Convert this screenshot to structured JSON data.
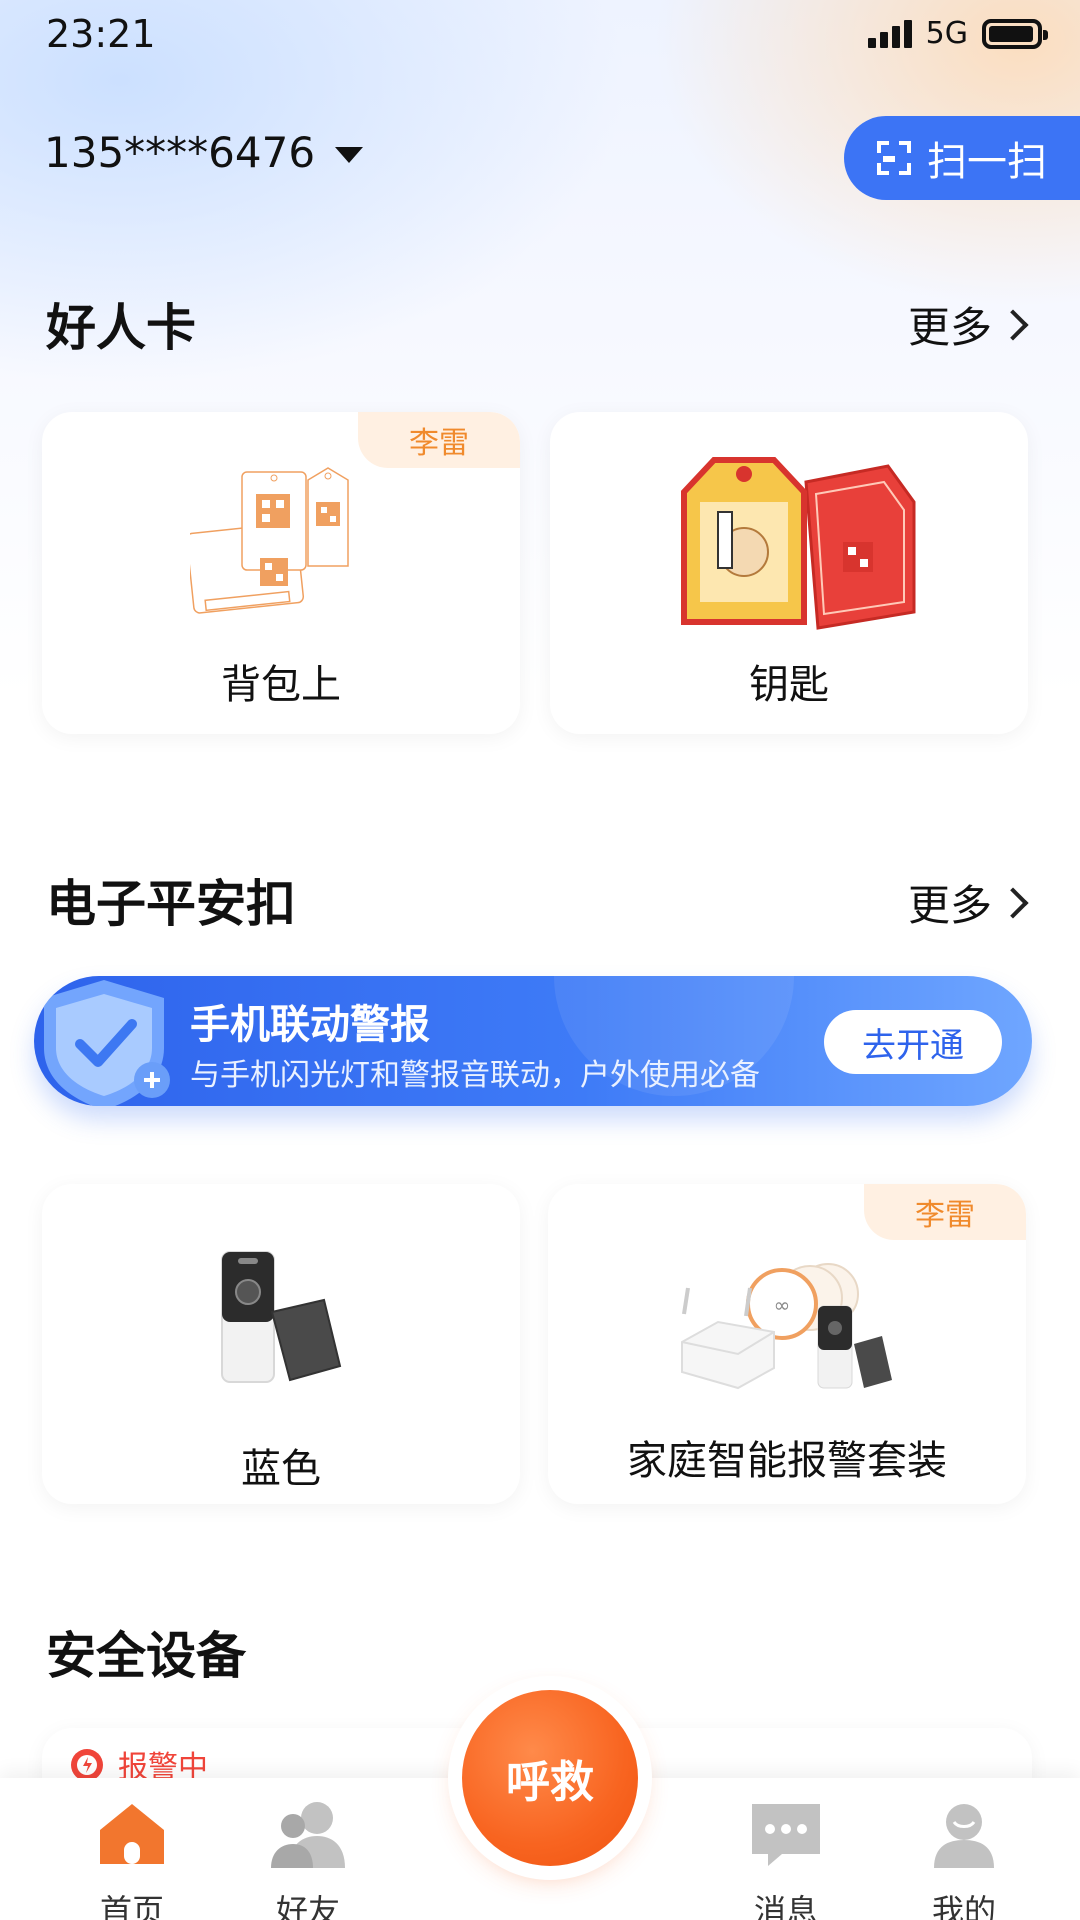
{
  "status_bar": {
    "time": "23:21",
    "network": "5G"
  },
  "header": {
    "account": "135****6476",
    "scan_label": "扫一扫"
  },
  "good_person_card": {
    "title": "好人卡",
    "more_label": "更多",
    "cards": [
      {
        "label": "背包上",
        "owner": "李雷"
      },
      {
        "label": "钥匙"
      }
    ]
  },
  "safety_button": {
    "title": "电子平安扣",
    "more_label": "更多",
    "banner": {
      "title": "手机联动警报",
      "subtitle": "与手机闪光灯和警报音联动，户外使用必备",
      "button_label": "去开通"
    },
    "cards": [
      {
        "label": "蓝色"
      },
      {
        "label": "家庭智能报警套装",
        "owner": "李雷"
      }
    ]
  },
  "devices": {
    "title": "安全设备",
    "alarm_status": "报警中"
  },
  "bottom_nav": {
    "items": [
      {
        "label": "首页",
        "active": true
      },
      {
        "label": "好友"
      },
      {
        "label": "消息"
      },
      {
        "label": "我的"
      }
    ],
    "sos_label": "呼救"
  },
  "colors": {
    "accent_blue": "#3c74f5",
    "accent_orange": "#f86420",
    "tag_orange": "#f08a2c"
  }
}
